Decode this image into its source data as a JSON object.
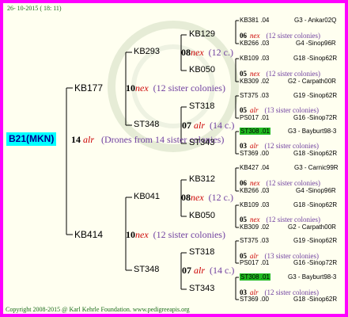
{
  "date": "26- 10-2015 ( 18: 11)",
  "copyright": "Copyright 2008-2015 @ Karl Kehrle Foundation.   www.pedigreeapis.org",
  "root": {
    "name": "B21(MKN)",
    "num": "14",
    "abbr": "alr",
    "desc": "(Drones from 14 sister colonies)"
  },
  "level1": [
    {
      "name": "KB177",
      "num": "10",
      "abbr": "nex",
      "desc": "(12 sister colonies)"
    },
    {
      "name": "KB414",
      "num": "10",
      "abbr": "nex",
      "desc": "(12 sister colonies)"
    }
  ],
  "level2": [
    {
      "name": "KB293",
      "num": "08",
      "abbr": "nex",
      "desc": "(12 c.)"
    },
    {
      "name": "ST348",
      "num": "07",
      "abbr": "alr",
      "desc": "(14 c.)"
    },
    {
      "name": "KB041",
      "num": "08",
      "abbr": "nex",
      "desc": "(12 c.)"
    },
    {
      "name": "ST348",
      "num": "07",
      "abbr": "alr",
      "desc": "(14 c.)"
    }
  ],
  "level3": [
    {
      "name": "KB129",
      "num": "06",
      "abbr": "nex",
      "desc": "(12 sister colonies)"
    },
    {
      "name": "KB050",
      "num": "05",
      "abbr": "nex",
      "desc": "(12 sister colonies)"
    },
    {
      "name": "ST318",
      "num": "05",
      "abbr": "alr",
      "desc": "(13 sister colonies)"
    },
    {
      "name": "ST343",
      "num": "03",
      "abbr": "alr",
      "desc": "(12 sister colonies)"
    },
    {
      "name": "KB312",
      "num": "06",
      "abbr": "nex",
      "desc": "(12 sister colonies)"
    },
    {
      "name": "KB050",
      "num": "05",
      "abbr": "nex",
      "desc": "(12 sister colonies)"
    },
    {
      "name": "ST318",
      "num": "05",
      "abbr": "alr",
      "desc": "(13 sister colonies)"
    },
    {
      "name": "ST343",
      "num": "03",
      "abbr": "alr",
      "desc": "(12 sister colonies)"
    }
  ],
  "leaves": [
    {
      "name": "KB381 .04",
      "loc": "G3 - Ankar02Q",
      "hl": false
    },
    {
      "name": "KB266 .03",
      "loc": "G4 -Sinop96R",
      "hl": false
    },
    {
      "name": "KB109 .03",
      "loc": "G18 -Sinop62R",
      "hl": false
    },
    {
      "name": "KB309 .02",
      "loc": "G2 - Carpath00R",
      "hl": false
    },
    {
      "name": "ST375 .03",
      "loc": "G19 -Sinop62R",
      "hl": false
    },
    {
      "name": "PS017 .01",
      "loc": "G16 -Sinop72R",
      "hl": false
    },
    {
      "name": "ST308 .01",
      "loc": "G3 - Bayburt98-3",
      "hl": true
    },
    {
      "name": "ST369 .00",
      "loc": "G18 -Sinop62R",
      "hl": false
    },
    {
      "name": "KB427 .04",
      "loc": "G3 - Carnic99R",
      "hl": false
    },
    {
      "name": "KB266 .03",
      "loc": "G4 -Sinop96R",
      "hl": false
    },
    {
      "name": "KB109 .03",
      "loc": "G18 -Sinop62R",
      "hl": false
    },
    {
      "name": "KB309 .02",
      "loc": "G2 - Carpath00R",
      "hl": false
    },
    {
      "name": "ST375 .03",
      "loc": "G19 -Sinop62R",
      "hl": false
    },
    {
      "name": "PS017 .01",
      "loc": "G16 -Sinop72R",
      "hl": false
    },
    {
      "name": "ST308 .01",
      "loc": "G3 - Bayburt98-3",
      "hl": true
    },
    {
      "name": "ST369 .00",
      "loc": "G18 -Sinop62R",
      "hl": false
    }
  ]
}
